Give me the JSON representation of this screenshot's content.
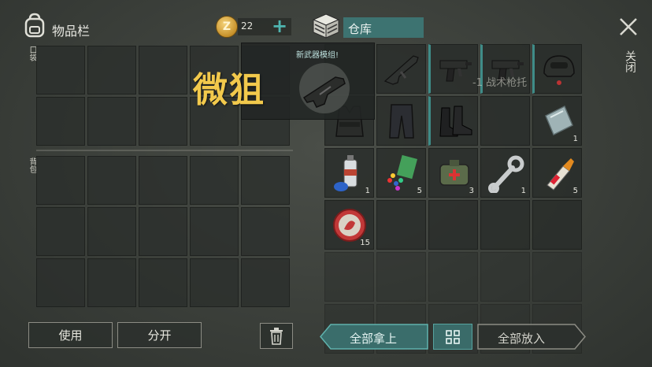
{
  "header": {
    "inventory_title": "物品栏",
    "coin_symbol": "Z",
    "coin_count": "22",
    "storage_title": "仓库",
    "close_label": "关闭"
  },
  "inventory": {
    "pocket_label": "口袋",
    "backpack_label": "背包"
  },
  "popup": {
    "title": "新武器模组!",
    "big_text": "微狙",
    "ghost_text": "-1 战术枪托"
  },
  "storage_items": [
    {
      "icon": "rifle-icon",
      "qty": ""
    },
    {
      "icon": "smg-icon",
      "qty": ""
    },
    {
      "icon": "smg-icon",
      "qty": ""
    },
    {
      "icon": "helmet-icon",
      "qty": ""
    },
    {
      "icon": "vest-icon",
      "qty": ""
    },
    {
      "icon": "pants-icon",
      "qty": ""
    },
    {
      "icon": "boots-icon",
      "qty": ""
    },
    {
      "icon": "metal-plate-icon",
      "qty": "1"
    },
    {
      "icon": "spray-can-icon",
      "qty": "1"
    },
    {
      "icon": "pills-icon",
      "qty": "5"
    },
    {
      "icon": "medkit-icon",
      "qty": "3"
    },
    {
      "icon": "wrench-icon",
      "qty": "1"
    },
    {
      "icon": "glue-icon",
      "qty": "5"
    },
    {
      "icon": "bottle-cap-icon",
      "qty": "15"
    }
  ],
  "buttons": {
    "use": "使用",
    "split": "分开",
    "take_all": "全部拿上",
    "put_all": "全部放入"
  },
  "colors": {
    "accent": "#3d7371",
    "highlight_text": "#f2c94c"
  }
}
